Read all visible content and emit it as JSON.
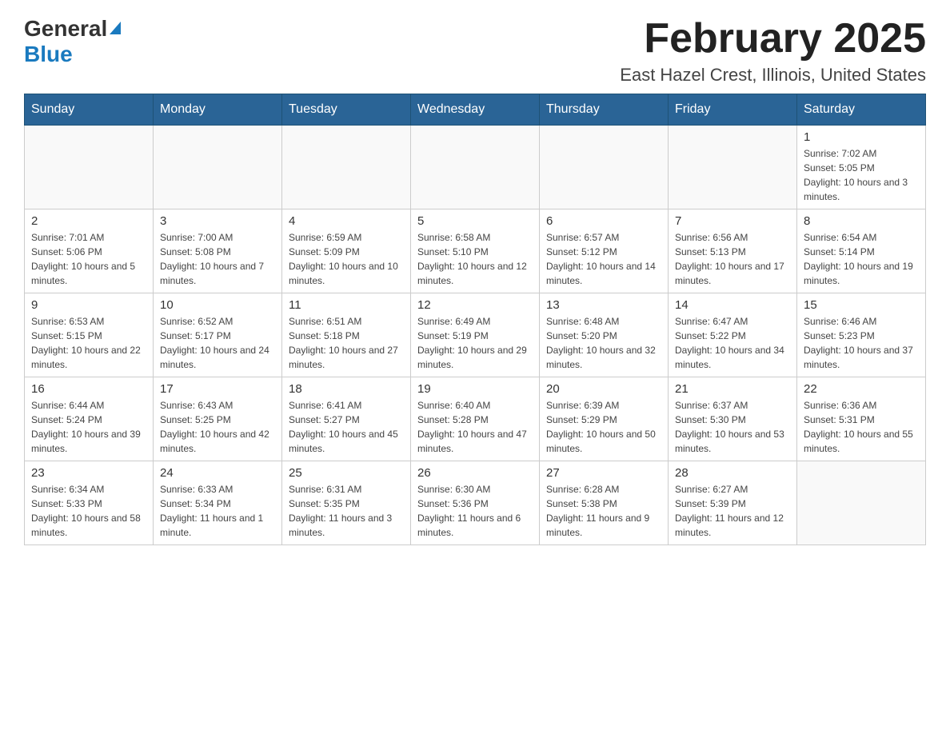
{
  "logo": {
    "general": "General",
    "blue": "Blue"
  },
  "title": "February 2025",
  "subtitle": "East Hazel Crest, Illinois, United States",
  "weekdays": [
    "Sunday",
    "Monday",
    "Tuesday",
    "Wednesday",
    "Thursday",
    "Friday",
    "Saturday"
  ],
  "weeks": [
    [
      {
        "day": "",
        "info": ""
      },
      {
        "day": "",
        "info": ""
      },
      {
        "day": "",
        "info": ""
      },
      {
        "day": "",
        "info": ""
      },
      {
        "day": "",
        "info": ""
      },
      {
        "day": "",
        "info": ""
      },
      {
        "day": "1",
        "info": "Sunrise: 7:02 AM\nSunset: 5:05 PM\nDaylight: 10 hours and 3 minutes."
      }
    ],
    [
      {
        "day": "2",
        "info": "Sunrise: 7:01 AM\nSunset: 5:06 PM\nDaylight: 10 hours and 5 minutes."
      },
      {
        "day": "3",
        "info": "Sunrise: 7:00 AM\nSunset: 5:08 PM\nDaylight: 10 hours and 7 minutes."
      },
      {
        "day": "4",
        "info": "Sunrise: 6:59 AM\nSunset: 5:09 PM\nDaylight: 10 hours and 10 minutes."
      },
      {
        "day": "5",
        "info": "Sunrise: 6:58 AM\nSunset: 5:10 PM\nDaylight: 10 hours and 12 minutes."
      },
      {
        "day": "6",
        "info": "Sunrise: 6:57 AM\nSunset: 5:12 PM\nDaylight: 10 hours and 14 minutes."
      },
      {
        "day": "7",
        "info": "Sunrise: 6:56 AM\nSunset: 5:13 PM\nDaylight: 10 hours and 17 minutes."
      },
      {
        "day": "8",
        "info": "Sunrise: 6:54 AM\nSunset: 5:14 PM\nDaylight: 10 hours and 19 minutes."
      }
    ],
    [
      {
        "day": "9",
        "info": "Sunrise: 6:53 AM\nSunset: 5:15 PM\nDaylight: 10 hours and 22 minutes."
      },
      {
        "day": "10",
        "info": "Sunrise: 6:52 AM\nSunset: 5:17 PM\nDaylight: 10 hours and 24 minutes."
      },
      {
        "day": "11",
        "info": "Sunrise: 6:51 AM\nSunset: 5:18 PM\nDaylight: 10 hours and 27 minutes."
      },
      {
        "day": "12",
        "info": "Sunrise: 6:49 AM\nSunset: 5:19 PM\nDaylight: 10 hours and 29 minutes."
      },
      {
        "day": "13",
        "info": "Sunrise: 6:48 AM\nSunset: 5:20 PM\nDaylight: 10 hours and 32 minutes."
      },
      {
        "day": "14",
        "info": "Sunrise: 6:47 AM\nSunset: 5:22 PM\nDaylight: 10 hours and 34 minutes."
      },
      {
        "day": "15",
        "info": "Sunrise: 6:46 AM\nSunset: 5:23 PM\nDaylight: 10 hours and 37 minutes."
      }
    ],
    [
      {
        "day": "16",
        "info": "Sunrise: 6:44 AM\nSunset: 5:24 PM\nDaylight: 10 hours and 39 minutes."
      },
      {
        "day": "17",
        "info": "Sunrise: 6:43 AM\nSunset: 5:25 PM\nDaylight: 10 hours and 42 minutes."
      },
      {
        "day": "18",
        "info": "Sunrise: 6:41 AM\nSunset: 5:27 PM\nDaylight: 10 hours and 45 minutes."
      },
      {
        "day": "19",
        "info": "Sunrise: 6:40 AM\nSunset: 5:28 PM\nDaylight: 10 hours and 47 minutes."
      },
      {
        "day": "20",
        "info": "Sunrise: 6:39 AM\nSunset: 5:29 PM\nDaylight: 10 hours and 50 minutes."
      },
      {
        "day": "21",
        "info": "Sunrise: 6:37 AM\nSunset: 5:30 PM\nDaylight: 10 hours and 53 minutes."
      },
      {
        "day": "22",
        "info": "Sunrise: 6:36 AM\nSunset: 5:31 PM\nDaylight: 10 hours and 55 minutes."
      }
    ],
    [
      {
        "day": "23",
        "info": "Sunrise: 6:34 AM\nSunset: 5:33 PM\nDaylight: 10 hours and 58 minutes."
      },
      {
        "day": "24",
        "info": "Sunrise: 6:33 AM\nSunset: 5:34 PM\nDaylight: 11 hours and 1 minute."
      },
      {
        "day": "25",
        "info": "Sunrise: 6:31 AM\nSunset: 5:35 PM\nDaylight: 11 hours and 3 minutes."
      },
      {
        "day": "26",
        "info": "Sunrise: 6:30 AM\nSunset: 5:36 PM\nDaylight: 11 hours and 6 minutes."
      },
      {
        "day": "27",
        "info": "Sunrise: 6:28 AM\nSunset: 5:38 PM\nDaylight: 11 hours and 9 minutes."
      },
      {
        "day": "28",
        "info": "Sunrise: 6:27 AM\nSunset: 5:39 PM\nDaylight: 11 hours and 12 minutes."
      },
      {
        "day": "",
        "info": ""
      }
    ]
  ]
}
